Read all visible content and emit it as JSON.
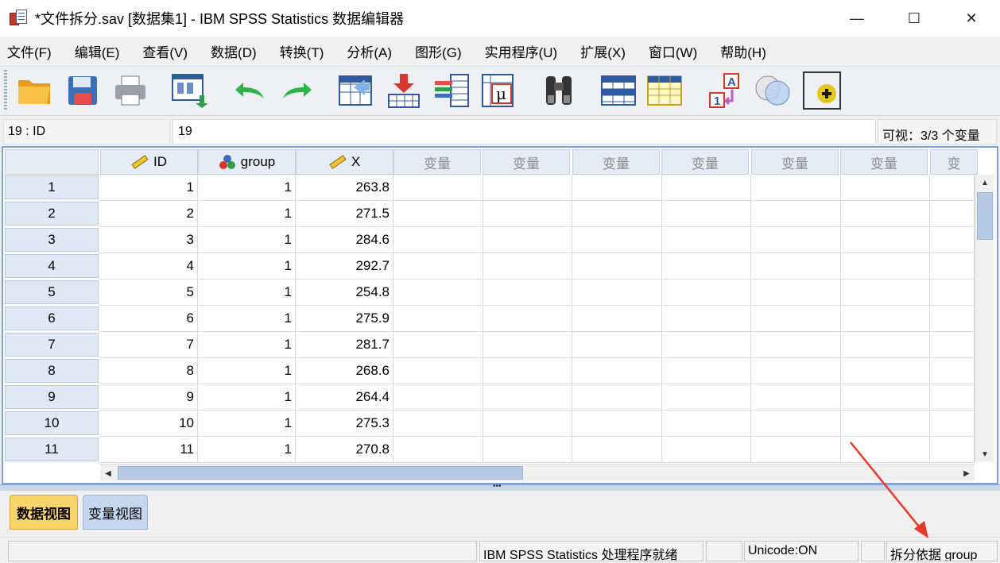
{
  "window": {
    "title": "*文件拆分.sav [数据集1] - IBM SPSS Statistics 数据编辑器",
    "minimize": "—",
    "maximize": "☐",
    "close": "✕"
  },
  "menu": [
    "文件(F)",
    "编辑(E)",
    "查看(V)",
    "数据(D)",
    "转换(T)",
    "分析(A)",
    "图形(G)",
    "实用程序(U)",
    "扩展(X)",
    "窗口(W)",
    "帮助(H)"
  ],
  "toolbar": {
    "icons": [
      "open-folder-icon",
      "save-icon",
      "print-icon",
      "recall-dialog-icon",
      "undo-icon",
      "redo-icon",
      "goto-case-icon",
      "goto-variable-icon",
      "variables-icon",
      "run-descriptives-icon",
      "find-icon",
      "insert-cases-icon",
      "insert-variable-icon",
      "value-labels-icon",
      "use-sets-icon",
      "split-file-icon"
    ]
  },
  "editbar": {
    "cell_name": "19 : ID",
    "cell_value": "19",
    "visible_count": "可视：3/3 个变量"
  },
  "grid": {
    "columns": [
      {
        "name": "ID",
        "icon": "scale-ruler-icon"
      },
      {
        "name": "group",
        "icon": "nominal-balls-icon"
      },
      {
        "name": "X",
        "icon": "scale-ruler-icon"
      }
    ],
    "empty_var_label": "变量",
    "empty_var_partial": "变",
    "rows": [
      {
        "n": "1",
        "id": "1",
        "group": "1",
        "x": "263.8"
      },
      {
        "n": "2",
        "id": "2",
        "group": "1",
        "x": "271.5"
      },
      {
        "n": "3",
        "id": "3",
        "group": "1",
        "x": "284.6"
      },
      {
        "n": "4",
        "id": "4",
        "group": "1",
        "x": "292.7"
      },
      {
        "n": "5",
        "id": "5",
        "group": "1",
        "x": "254.8"
      },
      {
        "n": "6",
        "id": "6",
        "group": "1",
        "x": "275.9"
      },
      {
        "n": "7",
        "id": "7",
        "group": "1",
        "x": "281.7"
      },
      {
        "n": "8",
        "id": "8",
        "group": "1",
        "x": "268.6"
      },
      {
        "n": "9",
        "id": "9",
        "group": "1",
        "x": "264.4"
      },
      {
        "n": "10",
        "id": "10",
        "group": "1",
        "x": "275.3"
      },
      {
        "n": "11",
        "id": "11",
        "group": "1",
        "x": "270.8"
      }
    ]
  },
  "tabs": {
    "data_view": "数据视图",
    "variable_view": "变量视图"
  },
  "status": {
    "processor": "IBM SPSS Statistics 处理程序就绪",
    "unicode": "Unicode:ON",
    "split": "拆分依据 group"
  },
  "colors": {
    "annotation_arrow": "#e8382a",
    "active_tab": "#f7d56a"
  }
}
